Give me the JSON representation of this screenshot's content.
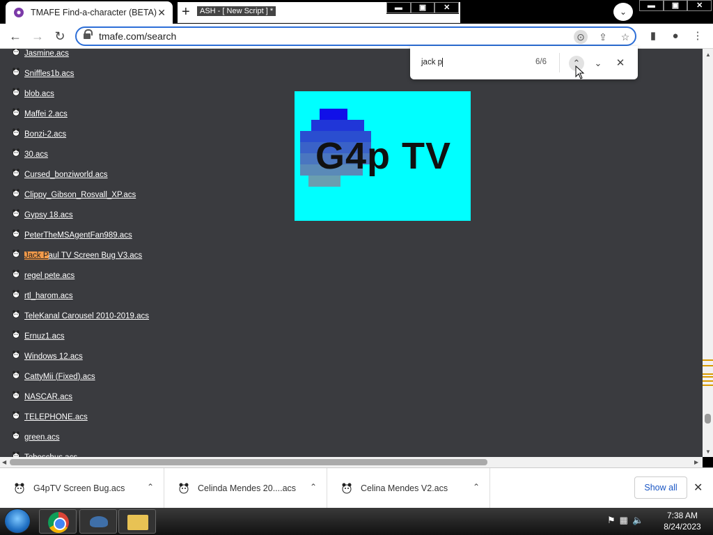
{
  "browser": {
    "active_tab_title": "TMAFE Find-a-character (BETA)",
    "ash_window_title": "ASH - [ New Script ] *",
    "url": "tmafe.com/search"
  },
  "find_bar": {
    "query": "jack p",
    "count": "6/6"
  },
  "files": [
    {
      "name": "Jasmine.acs"
    },
    {
      "name": "Sniffles1b.acs"
    },
    {
      "name": "blob.acs"
    },
    {
      "name": "Maffei 2.acs"
    },
    {
      "name": "Bonzi-2.acs"
    },
    {
      "name": "30.acs"
    },
    {
      "name": "Cursed_bonziworld.acs"
    },
    {
      "name": "Clippy_Gibson_Rosvall_XP.acs"
    },
    {
      "name": "Gypsy 18.acs"
    },
    {
      "name": "PeterTheMSAgentFan989.acs"
    },
    {
      "name": "Jack Paul TV Screen Bug V3.acs",
      "highlight": "Jack P",
      "rest": "aul TV Screen Bug V3.acs"
    },
    {
      "name": "regel pete.acs"
    },
    {
      "name": "rtl_harom.acs"
    },
    {
      "name": "TeleKanal Carousel 2010-2019.acs"
    },
    {
      "name": "Ernuz1.acs"
    },
    {
      "name": "Windows 12.acs"
    },
    {
      "name": "CattyMii (Fixed).acs"
    },
    {
      "name": "NASCAR.acs"
    },
    {
      "name": "TELEPHONE.acs"
    },
    {
      "name": "green.acs"
    },
    {
      "name": "Toboschus.acs"
    }
  ],
  "preview_image": {
    "text": "G4p TV"
  },
  "downloads": [
    {
      "name": "G4pTV Screen Bug.acs"
    },
    {
      "name": "Celinda Mendes 20....acs"
    },
    {
      "name": "Celina Mendes V2.acs"
    }
  ],
  "download_bar": {
    "show_all": "Show all"
  },
  "taskbar": {
    "time": "7:38 AM",
    "date": "8/24/2023"
  },
  "colors": {
    "page_bg": "#3a3b3f",
    "find_highlight": "#f29a4a",
    "preview_bg": "#00ffff",
    "link_accent": "#1a56c4"
  }
}
